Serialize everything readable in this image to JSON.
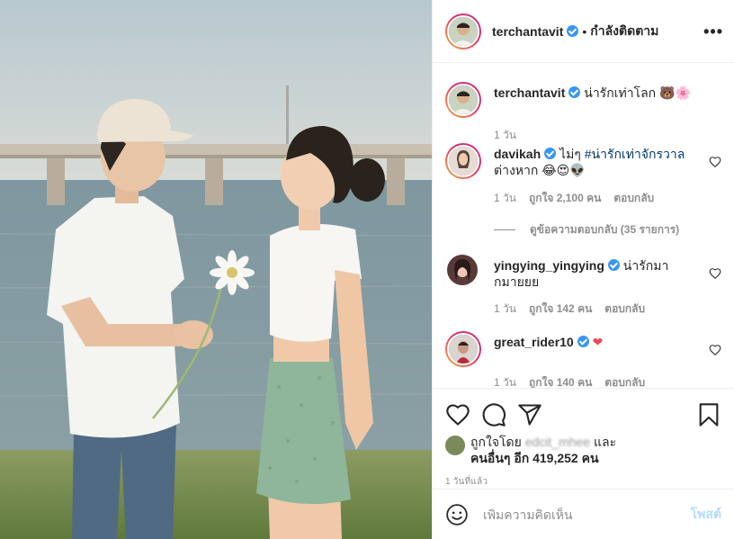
{
  "header": {
    "username": "terchantavit",
    "dot": "•",
    "following_label": "กำลังติดตาม",
    "more_icon": "more-horizontal-icon"
  },
  "caption": {
    "username": "terchantavit",
    "text": "น่ารักเท่าโลก",
    "emojis": "🐻🌸",
    "time": "1 วัน"
  },
  "comments": [
    {
      "username": "davikah",
      "text_prefix": "ไม่ๆ ",
      "hashtag": "#น่ารักเท่าจักรวาล",
      "text_suffix": "ต่างหาก",
      "emojis": "😂😍👽",
      "time": "1 วัน",
      "likes": "ถูกใจ 2,100 คน",
      "reply_label": "ตอบกลับ",
      "view_replies": "ดูข้อความตอบกลับ (35 รายการ)"
    },
    {
      "username": "yingying_yingying",
      "text": "น่ารักมากมายยย",
      "time": "1 วัน",
      "likes": "ถูกใจ 142 คน",
      "reply_label": "ตอบกลับ"
    },
    {
      "username": "great_rider10",
      "emojis": "❤",
      "time": "1 วัน",
      "likes": "ถูกใจ 140 คน",
      "reply_label": "ตอบกลับ"
    }
  ],
  "actions": {
    "like_icon": "heart-icon",
    "comment_icon": "comment-icon",
    "share_icon": "send-icon",
    "save_icon": "bookmark-icon"
  },
  "liked_by": {
    "prefix": "ถูกใจโดย",
    "blurred_user": "edcit_mhee",
    "and": "และ",
    "others": "คนอื่นๆ อีก 419,252 คน"
  },
  "post_time": "1 วันที่แล้ว",
  "add_comment": {
    "placeholder": "เพิ่มความคิดเห็น",
    "post_label": "โพสต์"
  },
  "colors": {
    "verified": "#3897f0",
    "hashtag": "#00376b",
    "muted": "#8e8e8e",
    "post_button_disabled": "#b3dbff",
    "heart_red": "#ed4956"
  }
}
